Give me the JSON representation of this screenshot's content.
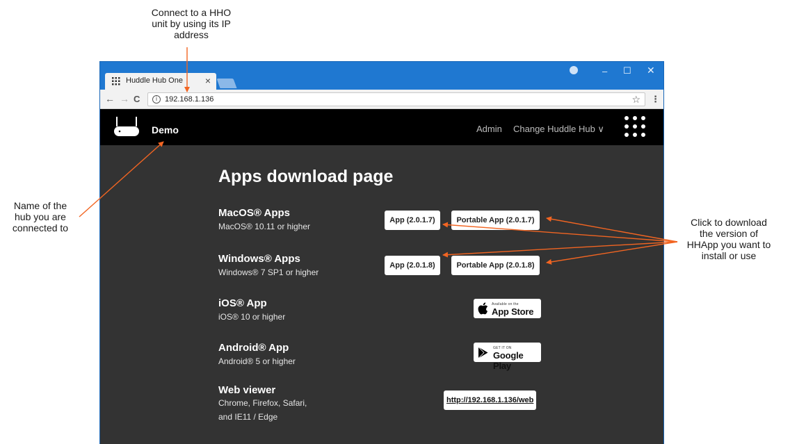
{
  "annotations": {
    "ip_note": [
      "Connect to a HHO",
      "unit by using its IP",
      "address"
    ],
    "hub_note": [
      "Name of the",
      "hub you are",
      "connected to"
    ],
    "download_note": [
      "Click to download",
      "the version of",
      "HHApp you want to",
      "install or use"
    ],
    "arrow_color": "#f26522"
  },
  "browser": {
    "tab_title": "Huddle Hub One",
    "tab_close": "×",
    "url": "192.168.1.136",
    "info_icon": "i",
    "star_icon": "☆",
    "menu_icon": "⋮",
    "back_icon": "←",
    "forward_icon": "→",
    "reload_icon": "C",
    "window_controls": {
      "minimize": "–",
      "maximize": "☐",
      "close": "✕"
    },
    "accent_color": "#1f78d1"
  },
  "header": {
    "hub_name": "Demo",
    "admin_link": "Admin",
    "change_hub": "Change Huddle Hub ∨",
    "logo_icon": "router-icon",
    "menu_icon": "apps-grid-icon"
  },
  "main": {
    "heading": "Apps download page",
    "apps": [
      {
        "name": "MacOS® Apps",
        "requirement": "MacOS® 10.11 or higher",
        "buttons": [
          "App (2.0.1.7)",
          "Portable App (2.0.1.7)"
        ]
      },
      {
        "name": "Windows® Apps",
        "requirement": "Windows® 7 SP1 or higher",
        "buttons": [
          "App (2.0.1.8)",
          "Portable App (2.0.1.8)"
        ]
      },
      {
        "name": "iOS® App",
        "requirement": "iOS® 10 or higher",
        "store_small": "Available on the",
        "store_big": "App Store"
      },
      {
        "name": "Android® App",
        "requirement": "Android® 5 or higher",
        "store_small": "GET IT ON",
        "store_big": "Google Play"
      },
      {
        "name": "Web viewer",
        "requirement_lines": [
          "Chrome, Firefox, Safari,",
          "and IE11 / Edge"
        ],
        "link": "http://192.168.1.136/web"
      }
    ]
  }
}
